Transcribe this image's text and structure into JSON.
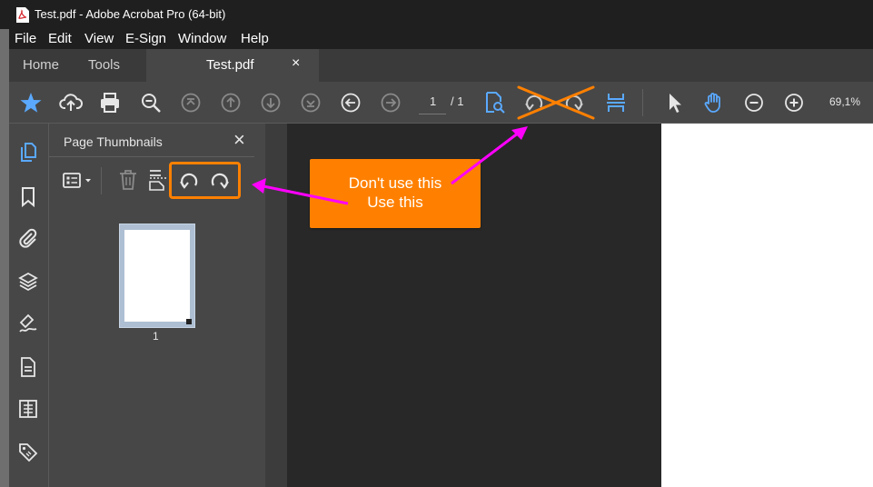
{
  "window": {
    "title": "Test.pdf - Adobe Acrobat Pro (64-bit)",
    "app_icon": "acrobat-pdf-icon"
  },
  "menu": [
    "File",
    "Edit",
    "View",
    "E-Sign",
    "Window",
    "Help"
  ],
  "tabs": {
    "home": "Home",
    "tools": "Tools",
    "document": "Test.pdf",
    "close_glyph": "×"
  },
  "toolbar": {
    "page_current": "1",
    "page_total": "/ 1",
    "zoom": "69,1%"
  },
  "panel": {
    "title": "Page Thumbnails",
    "close_glyph": "×",
    "thumbnail_label": "1"
  },
  "annotation": {
    "line1": "Don't use this",
    "line2": "Use this",
    "color": "#ff8000",
    "arrow_color": "#ff00ff"
  },
  "colors": {
    "accent_blue": "#5aa9ff",
    "titlebar": "#1f1f1f",
    "toolbar": "#474747"
  }
}
